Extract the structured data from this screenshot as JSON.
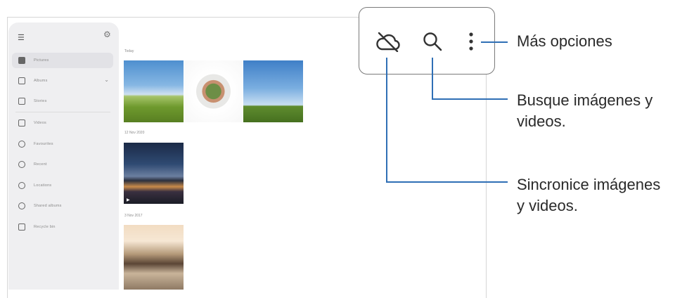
{
  "sidebar": {
    "items": [
      {
        "label": "Pictures",
        "active": true
      },
      {
        "label": "Albums"
      },
      {
        "label": "Stories"
      },
      {
        "label": "Videos"
      },
      {
        "label": "Favourites"
      },
      {
        "label": "Recent"
      },
      {
        "label": "Locations"
      },
      {
        "label": "Shared albums"
      },
      {
        "label": "Recycle bin"
      }
    ]
  },
  "gallery": {
    "sections": [
      {
        "date": "Today"
      },
      {
        "date": "12 Nov 2020"
      },
      {
        "date": "3 Nov 2017"
      }
    ]
  },
  "callouts": {
    "more_options": "Más opciones",
    "search": "Busque imágenes y videos.",
    "search_line1": "Busque imágenes y",
    "search_line2": "videos.",
    "sync_line1": "Sincronice imágenes",
    "sync_line2": "y videos."
  },
  "colors": {
    "accent_line": "#2f6fb5"
  }
}
